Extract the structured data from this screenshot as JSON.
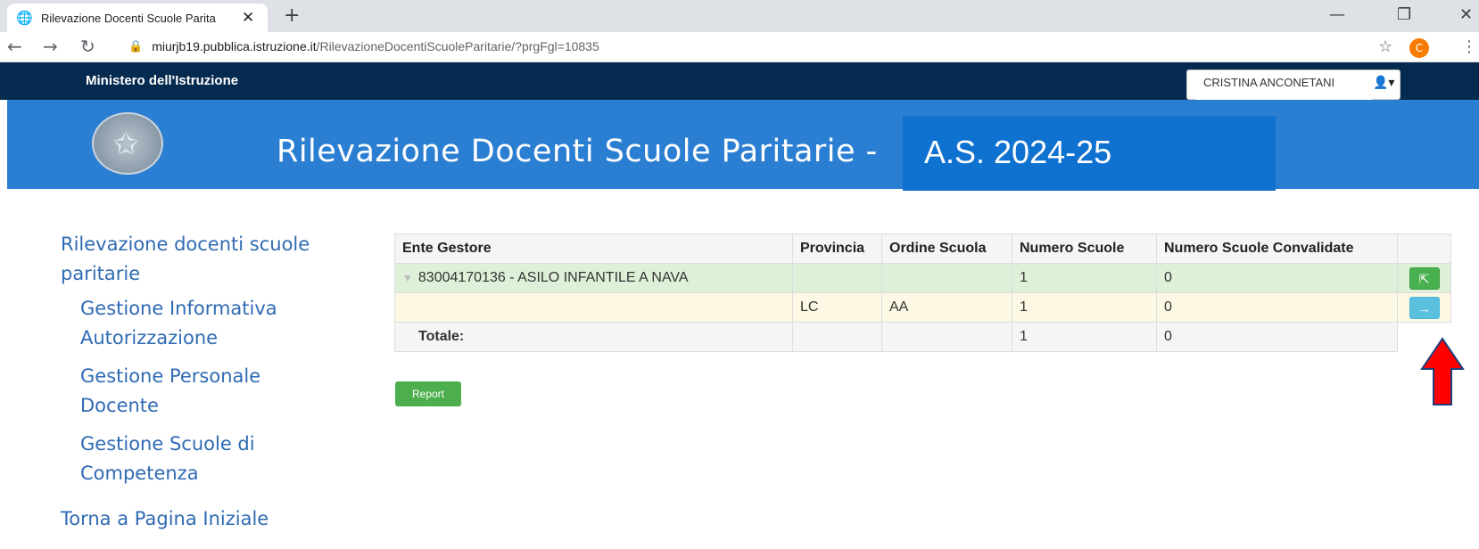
{
  "browser": {
    "tab_title": "Rilevazione Docenti Scuole Parita",
    "tab_close": "✕",
    "new_tab": "+",
    "url_host": "miurjb19.pubblica.istruzione.it",
    "url_path": "/RilevazioneDocentiScuoleParitarie/?prgFgl=10835",
    "profile_initial": "C",
    "minimize": "—",
    "restore": "❐",
    "close": "✕"
  },
  "header": {
    "ministry": "Ministero dell'Istruzione",
    "username": "CRISTINA ANCONETANI",
    "title": "Rilevazione Docenti Scuole Paritarie -",
    "year": "A.S. 2024-25",
    "accent": "#2b7fd3",
    "topbar_color": "#052a4f"
  },
  "sidebar": {
    "items": [
      {
        "label_line1": "Rilevazione docenti scuole",
        "label_line2": "paritarie"
      },
      {
        "label_line1": "Gestione Informativa",
        "label_line2": "Autorizzazione"
      },
      {
        "label_line1": "Gestione Personale",
        "label_line2": "Docente"
      },
      {
        "label_line1": "Gestione Scuole di",
        "label_line2": "Competenza"
      },
      {
        "label_line1": "Torna a Pagina Iniziale"
      }
    ]
  },
  "table": {
    "headers": [
      "Ente Gestore",
      "Provincia",
      "Ordine Scuola",
      "Numero Scuole",
      "Numero Scuole Convalidate",
      ""
    ],
    "rows": [
      {
        "ente": "83004170136 - ASILO INFANTILE A NAVA",
        "provincia": "",
        "ordine": "",
        "numero": "1",
        "convalidate": "0",
        "action_icon": "export-icon"
      },
      {
        "ente": "",
        "provincia": "LC",
        "ordine": "AA",
        "numero": "1",
        "convalidate": "0",
        "action_icon": "arrow-right-icon"
      }
    ],
    "total": {
      "label": "Totale:",
      "numero": "1",
      "convalidate": "0"
    }
  },
  "report_button": "Report"
}
